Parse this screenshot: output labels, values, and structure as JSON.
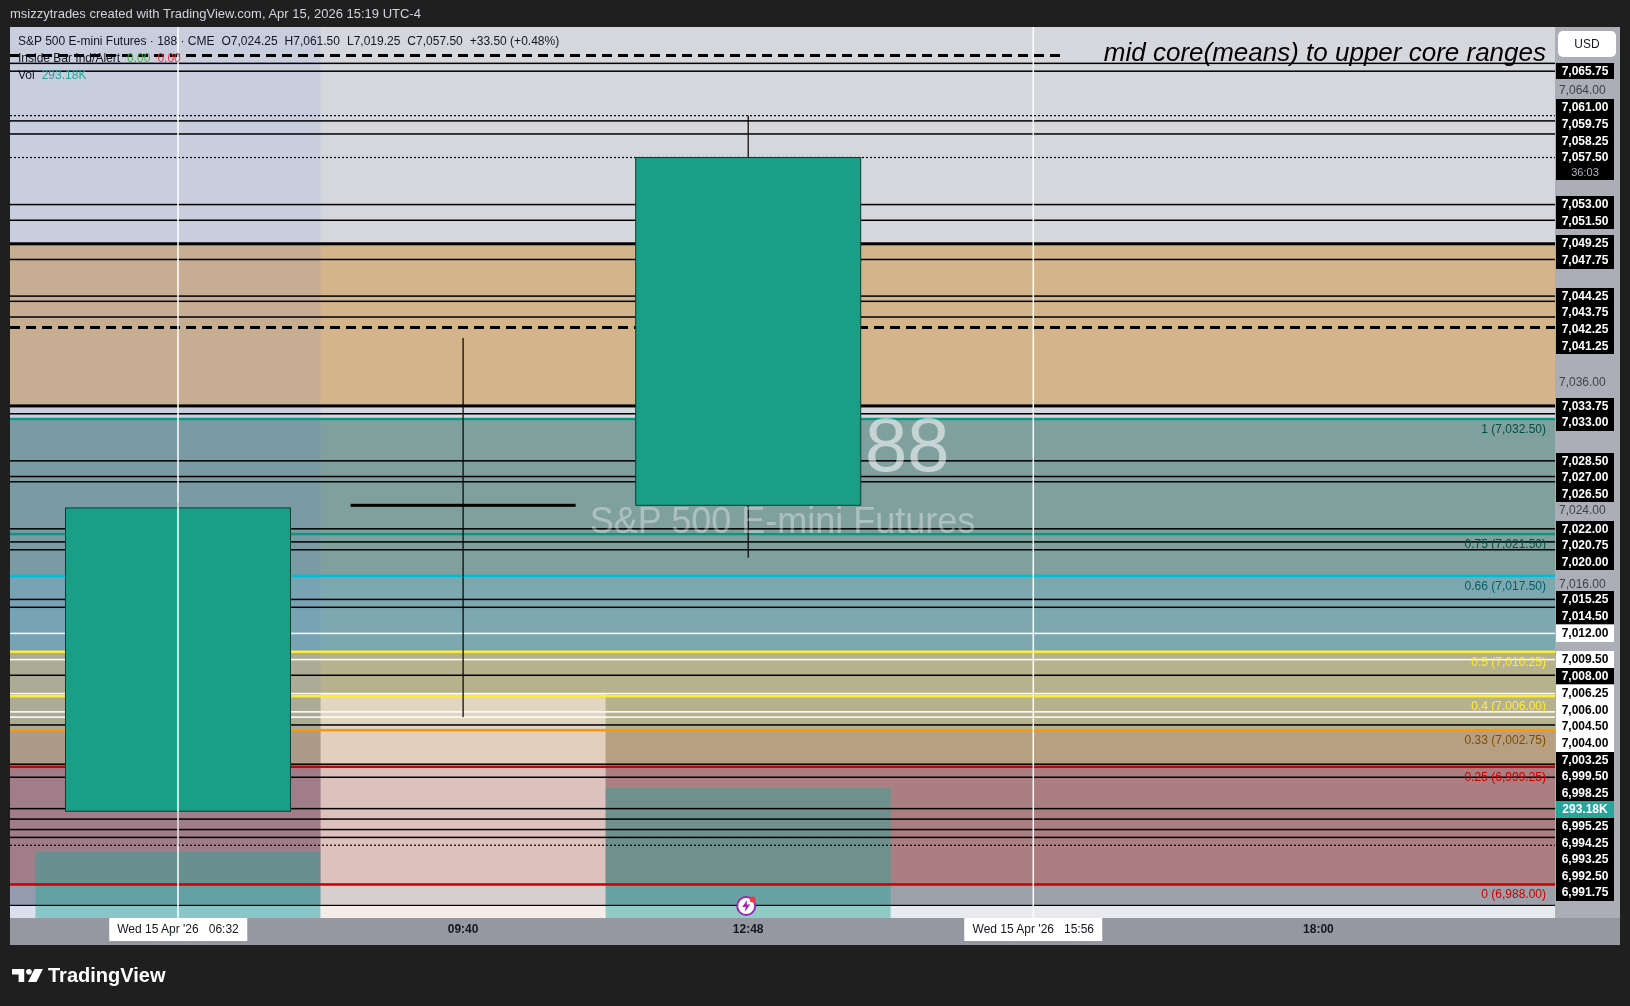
{
  "header": {
    "text": "msizzytrades created with TradingView.com, Apr 15, 2026 15:19 UTC-4"
  },
  "legend": {
    "symbol": "S&P 500 E-mini Futures · 188 · CME",
    "values": [
      "O7,024.25",
      "H7,061.50",
      "L7,019.25",
      "C7,057.50",
      "+33.50 (+0.48%)"
    ],
    "indicator": {
      "name": "Inside Bar Ind/Alert",
      "values": [
        {
          "text": "0.00",
          "color": "#4caf50"
        },
        {
          "text": "0.00",
          "color": "#f23645"
        }
      ]
    },
    "volume": {
      "name": "Vol",
      "value": "293.18K"
    }
  },
  "chart": {
    "annotation": "mid core(means) to upper core ranges",
    "symbol_watermark": "88",
    "watermark": "S&P 500 E-mini Futures",
    "fib_levels": [
      {
        "label": "1 (7,032.50)",
        "color": "#089981"
      },
      {
        "label": "0.75 (7,021.50)",
        "color": "#089981"
      },
      {
        "label": "0.66 (7,017.50)",
        "color": "#00bcd4"
      },
      {
        "label": "0.5 (7,010.25)",
        "color": "#ffeb3b"
      },
      {
        "label": "0.4 (7,006.00)",
        "color": "#ffeb3b"
      },
      {
        "label": "0.33 (7,002.75)",
        "color": "#ff9800"
      },
      {
        "label": "0.25 (6,999.25)",
        "color": "#cc0000"
      },
      {
        "label": "0 (6,988.00)",
        "color": "#cc0000"
      }
    ]
  },
  "price_axis": {
    "currency": "USD",
    "labels": [
      {
        "text": "7,065.75",
        "kind": "solid"
      },
      {
        "text": "7,064.00",
        "kind": "tick"
      },
      {
        "text": "7,061.00",
        "kind": "solid"
      },
      {
        "text": "7,059.75",
        "kind": "solid"
      },
      {
        "text": "7,058.25",
        "kind": "plain"
      },
      {
        "text": "7,057.50",
        "countdown": "36:03",
        "kind": "last"
      },
      {
        "text": "7,053.00",
        "kind": "solid"
      },
      {
        "text": "7,051.50",
        "kind": "solid"
      },
      {
        "text": "7,049.25",
        "kind": "thick"
      },
      {
        "text": "7,047.75",
        "kind": "solid"
      },
      {
        "text": "7,044.25",
        "kind": "solid"
      },
      {
        "text": "7,043.75",
        "kind": "solid"
      },
      {
        "text": "7,042.25",
        "kind": "solid"
      },
      {
        "text": "7,041.25",
        "kind": "dashed"
      },
      {
        "text": "7,036.00",
        "kind": "tick"
      },
      {
        "text": "7,033.75",
        "kind": "thick"
      },
      {
        "text": "7,033.00",
        "kind": "solid"
      },
      {
        "text": "7,028.50",
        "kind": "solid"
      },
      {
        "text": "7,027.00",
        "kind": "solid"
      },
      {
        "text": "7,026.50",
        "kind": "solid"
      },
      {
        "text": "7,024.00",
        "kind": "tick"
      },
      {
        "text": "7,022.00",
        "kind": "solid"
      },
      {
        "text": "7,020.75",
        "kind": "solid"
      },
      {
        "text": "7,020.00",
        "kind": "solid"
      },
      {
        "text": "7,016.00",
        "kind": "tick"
      },
      {
        "text": "7,015.25",
        "kind": "solid"
      },
      {
        "text": "7,014.50",
        "kind": "solid"
      },
      {
        "text": "7,012.00",
        "kind": "highlight"
      },
      {
        "text": "7,009.50",
        "kind": "highlight"
      },
      {
        "text": "7,008.00",
        "kind": "solid"
      },
      {
        "text": "7,006.25",
        "kind": "highlight"
      },
      {
        "text": "7,006.00",
        "kind": "highlight"
      },
      {
        "text": "7,004.50",
        "kind": "highlight"
      },
      {
        "text": "7,004.00",
        "kind": "highlight"
      },
      {
        "text": "7,003.25",
        "kind": "solid"
      },
      {
        "text": "6,999.50",
        "kind": "solid"
      },
      {
        "text": "6,998.25",
        "kind": "solid"
      },
      {
        "text": "293.18K",
        "kind": "volume"
      },
      {
        "text": "6,995.25",
        "kind": "solid"
      },
      {
        "text": "6,994.25",
        "kind": "solid"
      },
      {
        "text": "6,993.25",
        "kind": "solid"
      },
      {
        "text": "6,992.50",
        "kind": "solid"
      },
      {
        "text": "6,991.75",
        "kind": "dotted"
      }
    ]
  },
  "time_axis": {
    "labels": [
      {
        "text": "Wed 15 Apr '26   06:32",
        "kind": "marker"
      },
      {
        "text": "09:40",
        "kind": "tick"
      },
      {
        "text": "12:48",
        "kind": "tick"
      },
      {
        "text": "Wed 15 Apr '26   15:56",
        "kind": "marker"
      },
      {
        "text": "18:00",
        "kind": "tick"
      }
    ]
  },
  "footer": {
    "brand": "TradingView"
  }
}
